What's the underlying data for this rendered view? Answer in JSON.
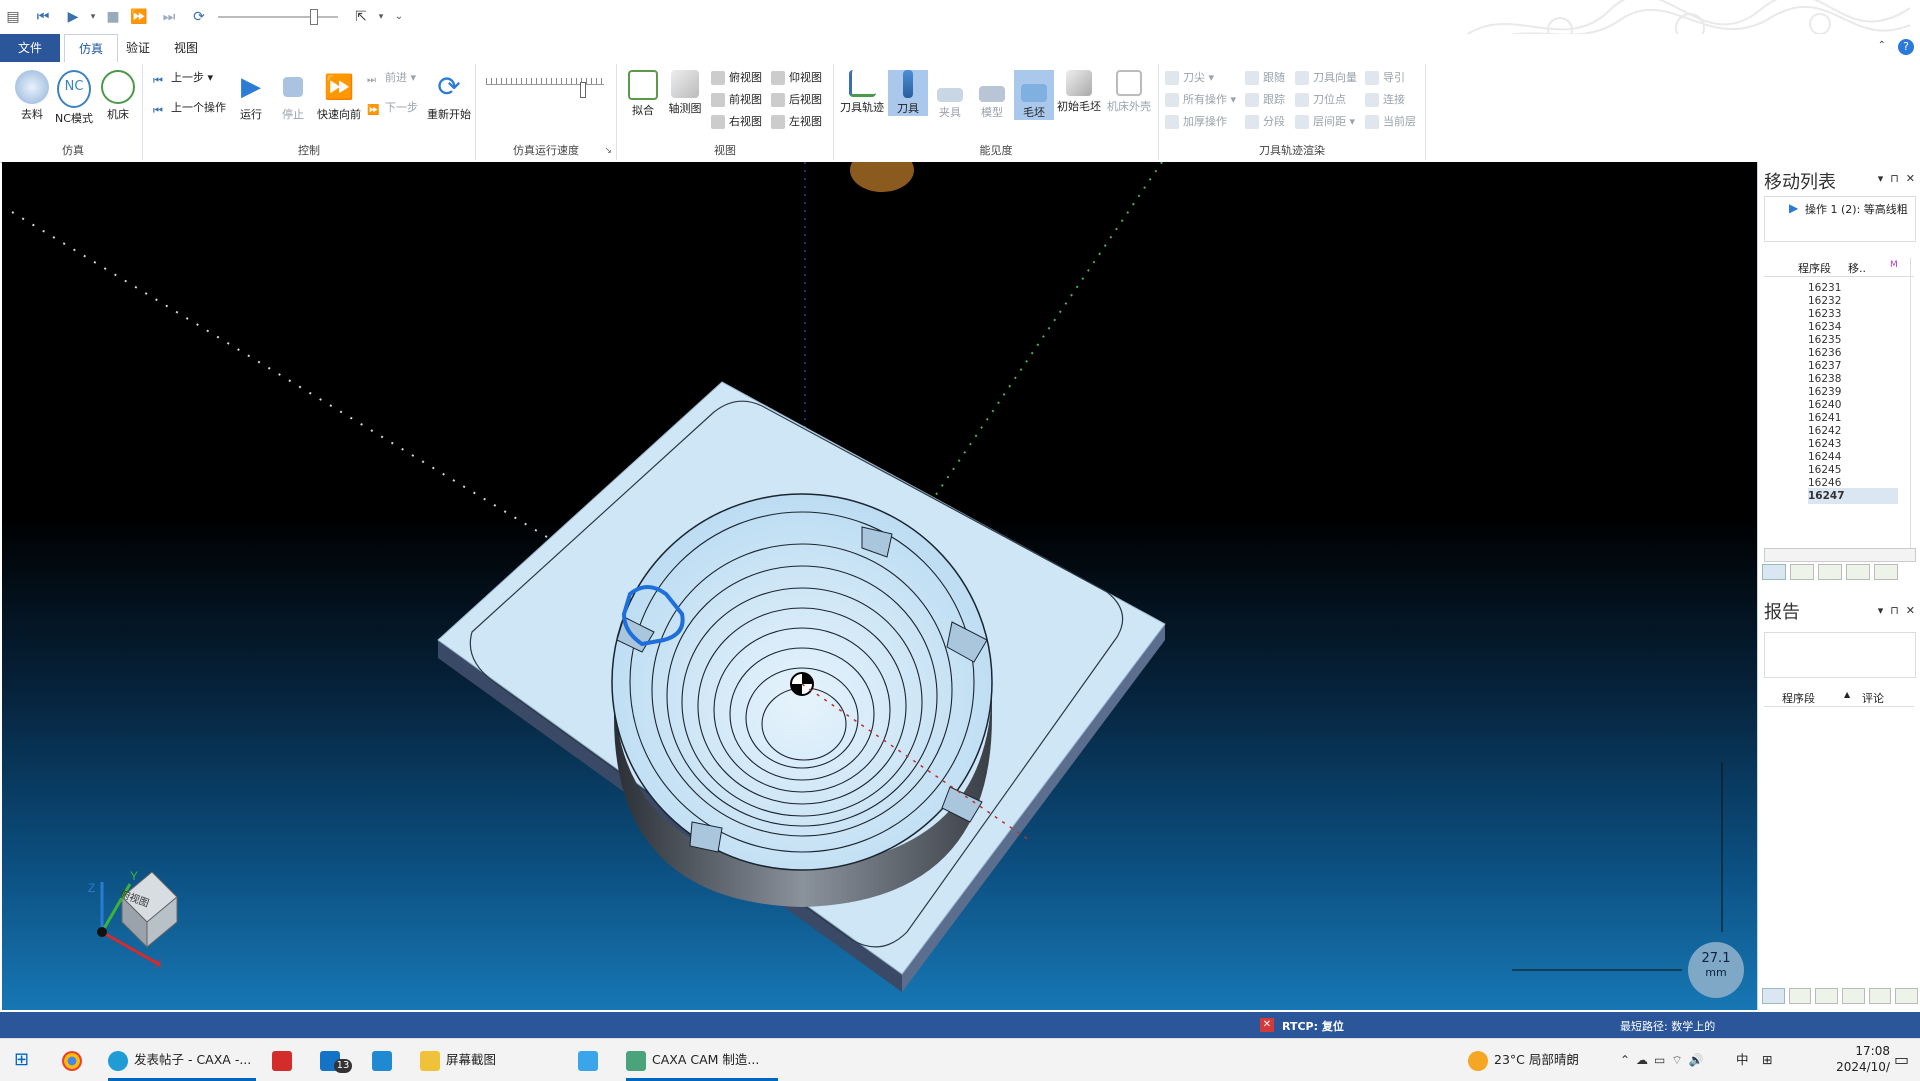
{
  "quick_access": {
    "icons": [
      "app-icon",
      "first-icon",
      "play-icon",
      "dropdown-icon",
      "stop-icon",
      "fast-forward-icon",
      "last-icon",
      "refresh-icon",
      "cursor-icon",
      "dropdown-icon",
      "customize-icon"
    ]
  },
  "tabs": [
    {
      "label": "文件"
    },
    {
      "label": "仿真"
    },
    {
      "label": "验证"
    },
    {
      "label": "视图"
    }
  ],
  "ribbon": {
    "sim": {
      "label": "仿真",
      "items": [
        "去料",
        "NC模式",
        "机床"
      ]
    },
    "control": {
      "label": "控制",
      "step_back": "上一步",
      "prev_op": "上一个操作",
      "run": "运行",
      "stop": "停止",
      "fast_fwd": "快速向前",
      "forward": "前进",
      "next_step": "下一步",
      "restart": "重新开始"
    },
    "speed": {
      "label": "仿真运行速度"
    },
    "views": {
      "label": "视图",
      "fit": "拟合",
      "iso": "轴测图",
      "top": "俯视图",
      "bottom": "仰视图",
      "front": "前视图",
      "back": "后视图",
      "right": "右视图",
      "left": "左视图"
    },
    "visibility": {
      "label": "能见度",
      "toolpath": "刀具轨迹",
      "tool": "刀具",
      "fixture": "夹具",
      "model": "模型",
      "stock": "毛坯",
      "init_stock": "初始毛坯",
      "machine": "机床外壳"
    },
    "render": {
      "label": "刀具轨迹渲染",
      "col1": [
        "刀尖",
        "所有操作",
        "加厚操作"
      ],
      "col2": [
        "跟随",
        "跟踪",
        "分段"
      ],
      "col3": [
        "刀具向量",
        "刀位点",
        "层间距"
      ],
      "col4": [
        "导引",
        "连接",
        "当前层"
      ]
    }
  },
  "move_list": {
    "title": "移动列表",
    "operation": "操作 1 (2): 等高线粗",
    "col_segment": "程序段",
    "col_move": "移..",
    "rows": [
      "16231",
      "16232",
      "16233",
      "16234",
      "16235",
      "16236",
      "16237",
      "16238",
      "16239",
      "16240",
      "16241",
      "16242",
      "16243",
      "16244",
      "16245",
      "16246",
      "16247"
    ],
    "selected": "16247"
  },
  "report": {
    "title": "报告",
    "col_segment": "程序段",
    "col_comment": "评论"
  },
  "viewport": {
    "cube_label": "俯视图",
    "scale_value": "27.1",
    "scale_unit": "mm"
  },
  "status": {
    "rtcp": "RTCP: 复位",
    "shortest": "最短路径: 数学上的"
  },
  "taskbar": {
    "apps": [
      {
        "label": "发表帖子 - CAXA -..."
      },
      {
        "label": "屏幕截图"
      },
      {
        "label": "CAXA CAM 制造..."
      }
    ],
    "badge": "13",
    "weather": "23°C 局部晴朗",
    "ime": "中",
    "time": "17:08",
    "date": "2024/10/"
  },
  "colors": {
    "accent": "#2b579a",
    "stock": "#cfe6f7",
    "toolpath": "#1e6fd9"
  }
}
